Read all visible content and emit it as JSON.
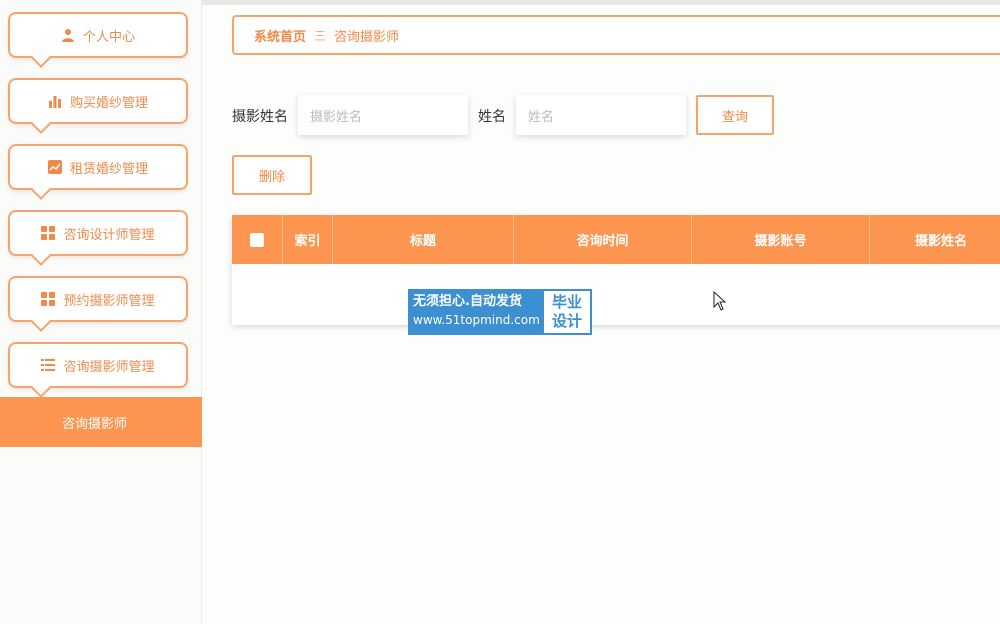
{
  "sidebar": {
    "items": [
      {
        "label": "个人中心",
        "icon": "user-icon"
      },
      {
        "label": "购买婚纱管理",
        "icon": "bar-chart-icon"
      },
      {
        "label": "租赁婚纱管理",
        "icon": "line-chart-icon"
      },
      {
        "label": "咨询设计师管理",
        "icon": "grid-icon"
      },
      {
        "label": "预约摄影师管理",
        "icon": "grid-icon"
      },
      {
        "label": "咨询摄影师管理",
        "icon": "list-icon"
      }
    ],
    "active_sub": "咨询摄影师"
  },
  "breadcrumb": {
    "home": "系统首页",
    "separator": "三",
    "current": "咨询摄影师"
  },
  "search": {
    "label1": "摄影姓名",
    "placeholder1": "摄影姓名",
    "label2": "姓名",
    "placeholder2": "姓名",
    "query_label": "查询"
  },
  "actions": {
    "delete_label": "删除"
  },
  "table": {
    "columns": [
      "索引",
      "标题",
      "咨询时间",
      "摄影账号",
      "摄影姓名"
    ]
  },
  "watermark": {
    "line1": "无须担心.自动发货",
    "line2": "www.51topmind.com",
    "badge1": "毕业",
    "badge2": "设计"
  },
  "colors": {
    "accent": "#fb9550",
    "border": "#f6a46b",
    "text_accent": "#f08a4b",
    "watermark_bg": "#3c8fd1"
  }
}
